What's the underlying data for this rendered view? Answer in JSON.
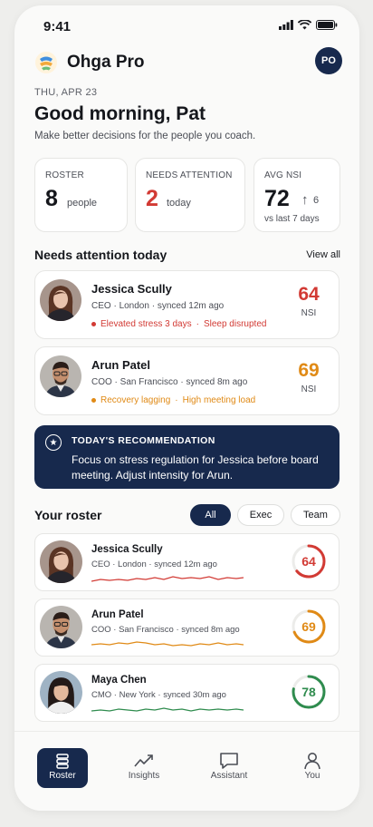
{
  "status": {
    "time": "9:41"
  },
  "header": {
    "app_name": "Ohga Pro",
    "avatar_initials": "PO"
  },
  "date": "THU, APR 23",
  "greeting": "Good morning, Pat",
  "subtitle": "Make better decisions for the people you coach.",
  "stats": {
    "roster": {
      "label": "ROSTER",
      "value": "8",
      "unit": "people"
    },
    "attention": {
      "label": "NEEDS ATTENTION",
      "value": "2",
      "unit": "today"
    },
    "nsi": {
      "label": "AVG NSI",
      "value": "72",
      "delta": "6",
      "unit": "vs last 7 days"
    }
  },
  "needs_attention": {
    "title": "Needs attention today",
    "view_all": "View all",
    "items": [
      {
        "name": "Jessica Scully",
        "role": "CEO",
        "location": "London",
        "synced": "synced 12m ago",
        "alert1": "Elevated stress 3 days",
        "alert2": "Sleep disrupted",
        "nsi": "64",
        "nsi_label": "NSI"
      },
      {
        "name": "Arun Patel",
        "role": "COO",
        "location": "San Francisco",
        "synced": "synced 8m ago",
        "alert1": "Recovery lagging",
        "alert2": "High meeting load",
        "nsi": "69",
        "nsi_label": "NSI"
      }
    ]
  },
  "recommendation": {
    "heading": "TODAY'S RECOMMENDATION",
    "body": "Focus on stress regulation for Jessica before board meeting. Adjust intensity for Arun."
  },
  "roster": {
    "title": "Your roster",
    "filters": [
      "All",
      "Exec",
      "Team"
    ],
    "selected_filter": "All",
    "items": [
      {
        "name": "Jessica Scully",
        "role": "CEO",
        "location": "London",
        "synced": "synced 12m ago",
        "score": "64",
        "color": "#d23a34",
        "progress": 0.64
      },
      {
        "name": "Arun Patel",
        "role": "COO",
        "location": "San Francisco",
        "synced": "synced 8m ago",
        "score": "69",
        "color": "#e08a16",
        "progress": 0.69
      },
      {
        "name": "Maya Chen",
        "role": "CMO",
        "location": "New York",
        "synced": "synced 30m ago",
        "score": "78",
        "color": "#2f8c4e",
        "progress": 0.78
      }
    ]
  },
  "tabs": [
    {
      "label": "Roster",
      "icon": "roster-icon",
      "active": true
    },
    {
      "label": "Insights",
      "icon": "insights-icon"
    },
    {
      "label": "Assistant",
      "icon": "chat-icon"
    },
    {
      "label": "You",
      "icon": "user-icon"
    }
  ],
  "colors": {
    "navy": "#17294d",
    "red": "#d23a34",
    "orange": "#e08a16",
    "green": "#2f8c4e"
  }
}
